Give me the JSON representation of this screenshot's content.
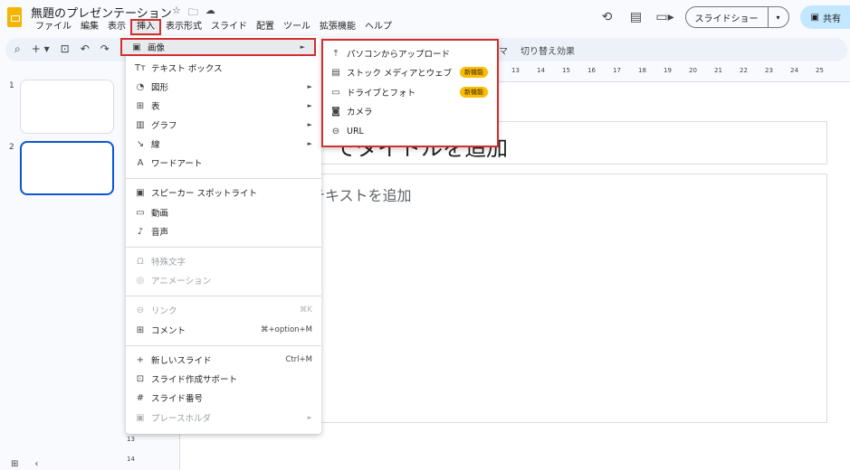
{
  "header": {
    "doc_title": "無題のプレゼンテーション",
    "menus": [
      "ファイル",
      "編集",
      "表示",
      "挿入",
      "表示形式",
      "スライド",
      "配置",
      "ツール",
      "拡張機能",
      "ヘルプ"
    ],
    "slideshow_label": "スライドショー",
    "share_label": "共有"
  },
  "toolbar": {
    "partial_label": "マ",
    "transition_label": "切り替え効果"
  },
  "ruler": {
    "ticks": [
      "13",
      "14",
      "15",
      "16",
      "17",
      "18",
      "19",
      "20",
      "21",
      "22",
      "23",
      "24",
      "25"
    ],
    "vticks": [
      "13",
      "14"
    ]
  },
  "slides": [
    "1",
    "2"
  ],
  "canvas": {
    "title_placeholder": "でタイトルを追加",
    "body_placeholder": "テキストを追加"
  },
  "insert_menu": {
    "items": [
      {
        "icon": "image-icon",
        "glyph": "▣",
        "label": "画像",
        "arrow": "►"
      },
      {
        "icon": "textbox-icon",
        "glyph": "Tт",
        "label": "テキスト ボックス"
      },
      {
        "icon": "shape-icon",
        "glyph": "◔",
        "label": "図形",
        "arrow": "►"
      },
      {
        "icon": "table-icon",
        "glyph": "⊞",
        "label": "表",
        "arrow": "►"
      },
      {
        "icon": "chart-icon",
        "glyph": "▥",
        "label": "グラフ",
        "arrow": "►"
      },
      {
        "icon": "line-icon",
        "glyph": "↘",
        "label": "線",
        "arrow": "►"
      },
      {
        "icon": "wordart-icon",
        "glyph": "A",
        "label": "ワードアート"
      },
      {
        "icon": "speaker-spotlight-icon",
        "glyph": "▣",
        "label": "スピーカー スポットライト"
      },
      {
        "icon": "video-icon",
        "glyph": "▭",
        "label": "動画"
      },
      {
        "icon": "audio-icon",
        "glyph": "♪",
        "label": "音声"
      },
      {
        "icon": "special-chars-icon",
        "glyph": "Ω",
        "label": "特殊文字"
      },
      {
        "icon": "animation-icon",
        "glyph": "◎",
        "label": "アニメーション"
      },
      {
        "icon": "link-icon",
        "glyph": "⊖",
        "label": "リンク",
        "shortcut": "⌘K"
      },
      {
        "icon": "comment-icon",
        "glyph": "⊞",
        "label": "コメント",
        "shortcut": "⌘+option+M"
      },
      {
        "icon": "plus-icon",
        "glyph": "+",
        "label": "新しいスライド",
        "shortcut": "Ctrl+M"
      },
      {
        "icon": "slide-assist-icon",
        "glyph": "⊡",
        "label": "スライド作成サポート"
      },
      {
        "icon": "hash-icon",
        "glyph": "#",
        "label": "スライド番号"
      },
      {
        "icon": "placeholder-icon",
        "glyph": "▣",
        "label": "プレースホルダ",
        "arrow": "►"
      }
    ]
  },
  "image_submenu": {
    "items": [
      {
        "icon": "upload-icon",
        "glyph": "⤒",
        "label": "パソコンからアップロード"
      },
      {
        "icon": "stock-icon",
        "glyph": "▤",
        "label": "ストック メディアとウェブ",
        "badge": "新機能"
      },
      {
        "icon": "folder-icon",
        "glyph": "▭",
        "label": "ドライブとフォト",
        "badge": "新機能"
      },
      {
        "icon": "camera-icon",
        "glyph": "◙",
        "label": "カメラ"
      },
      {
        "icon": "link-icon",
        "glyph": "⊖",
        "label": "URL"
      }
    ]
  },
  "colors": {
    "highlight_border": "#d32f2f",
    "selected_slide": "#0b57d0",
    "badge": "#fbbc04",
    "share_bg": "#c2e7ff"
  }
}
